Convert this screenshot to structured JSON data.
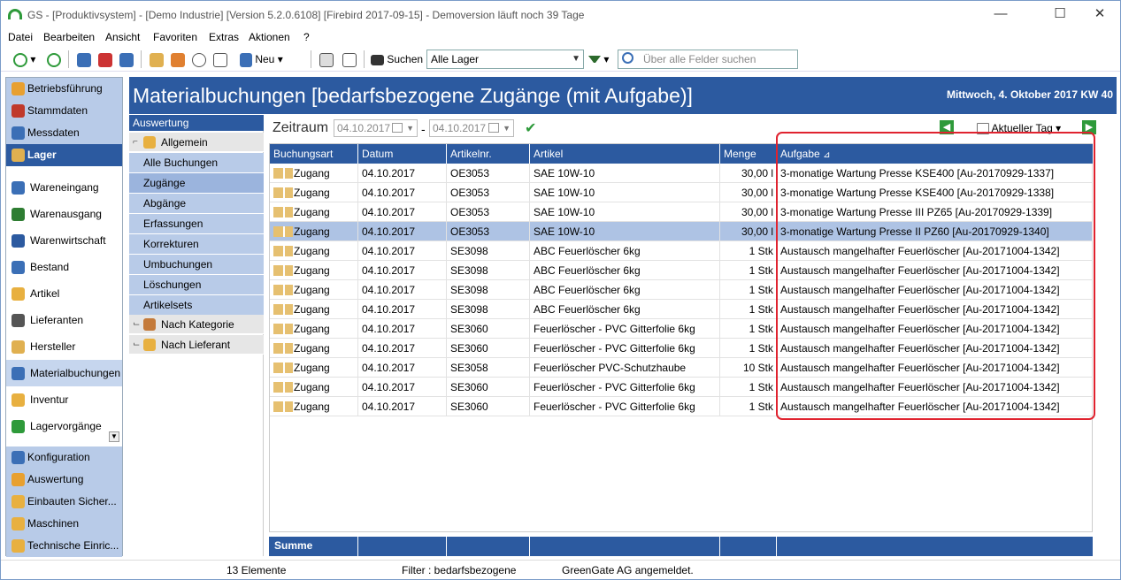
{
  "window": {
    "title": "GS - [Produktivsystem] - [Demo Industrie]  [Version  5.2.0.6108]  [Firebird 2017-09-15] - Demoversion läuft noch 39 Tage",
    "controls": [
      "—",
      "☐",
      "✕"
    ]
  },
  "menu": [
    "Datei",
    "Bearbeiten",
    "Ansicht",
    "Favoriten",
    "Extras",
    "Aktionen",
    "?"
  ],
  "toolbar": {
    "new_label": "Neu",
    "search_label": "Suchen",
    "store_value": "Alle Lager",
    "search_placeholder": "Über alle Felder suchen"
  },
  "sidebar": {
    "top_items": [
      {
        "label": "Betriebsführung",
        "icon": "sun-icon"
      },
      {
        "label": "Stammdaten",
        "icon": "books-icon"
      },
      {
        "label": "Messdaten",
        "icon": "pin-icon"
      },
      {
        "label": "Lager",
        "icon": "warehouse-icon",
        "active": true
      }
    ],
    "lager_items": [
      {
        "label": "Wareneingang",
        "icon": "goods-in-icon"
      },
      {
        "label": "Warenausgang",
        "icon": "goods-out-icon"
      },
      {
        "label": "Warenwirtschaft",
        "icon": "network-icon"
      },
      {
        "label": "Bestand",
        "icon": "stock-icon"
      },
      {
        "label": "Artikel",
        "icon": "key-icon"
      },
      {
        "label": "Lieferanten",
        "icon": "supplier-icon"
      },
      {
        "label": "Hersteller",
        "icon": "factory-icon"
      },
      {
        "label": "Materialbuchungen",
        "icon": "booking-icon",
        "selected": true
      },
      {
        "label": "Inventur",
        "icon": "inventory-icon"
      },
      {
        "label": "Lagervorgänge",
        "icon": "process-icon"
      }
    ],
    "bottom_items": [
      {
        "label": "Konfiguration",
        "icon": "config-icon"
      },
      {
        "label": "Auswertung",
        "icon": "report-icon"
      },
      {
        "label": "Einbauten Sicher...",
        "icon": "folder-icon"
      },
      {
        "label": "Maschinen",
        "icon": "folder-icon"
      },
      {
        "label": "Technische Einric...",
        "icon": "folder-icon"
      }
    ]
  },
  "header": {
    "title": "Materialbuchungen [bedarfsbezogene Zugänge (mit Aufgabe)]",
    "date": "Mittwoch, 4. Oktober 2017  KW 40"
  },
  "leftpanel": {
    "title": "Auswertung",
    "groups": {
      "allgemein": "Allgemein",
      "nach_kategorie": "Nach Kategorie",
      "nach_lieferant": "Nach Lieferant"
    },
    "items": [
      "Alle Buchungen",
      "Zugänge",
      "Abgänge",
      "Erfassungen",
      "Korrekturen",
      "Umbuchungen",
      "Löschungen",
      "Artikelsets"
    ]
  },
  "zeitraum": {
    "label": "Zeitraum",
    "from": "04.10.2017",
    "dash": "-",
    "to": "04.10.2017",
    "range_option": "Aktueller Tag"
  },
  "grid": {
    "columns": [
      "Buchungsart",
      "Datum",
      "Artikelnr.",
      "Artikel",
      "Menge",
      "Aufgabe"
    ],
    "rows": [
      {
        "art": "Zugang",
        "datum": "04.10.2017",
        "nr": "OE3053",
        "artikel": "SAE 10W-10",
        "menge": "30,00 l",
        "aufgabe": "3-monatige Wartung Presse KSE400 [Au-20170929-1337]"
      },
      {
        "art": "Zugang",
        "datum": "04.10.2017",
        "nr": "OE3053",
        "artikel": "SAE 10W-10",
        "menge": "30,00 l",
        "aufgabe": "3-monatige Wartung Presse KSE400 [Au-20170929-1338]"
      },
      {
        "art": "Zugang",
        "datum": "04.10.2017",
        "nr": "OE3053",
        "artikel": "SAE 10W-10",
        "menge": "30,00 l",
        "aufgabe": "3-monatige Wartung Presse III PZ65 [Au-20170929-1339]"
      },
      {
        "art": "Zugang",
        "datum": "04.10.2017",
        "nr": "OE3053",
        "artikel": "SAE 10W-10",
        "menge": "30,00 l",
        "aufgabe": "3-monatige Wartung Presse II PZ60 [Au-20170929-1340]",
        "highlight": true
      },
      {
        "art": "Zugang",
        "datum": "04.10.2017",
        "nr": "SE3098",
        "artikel": "ABC Feuerlöscher  6kg",
        "menge": "1 Stk",
        "aufgabe": "Austausch mangelhafter Feuerlöscher [Au-20171004-1342]"
      },
      {
        "art": "Zugang",
        "datum": "04.10.2017",
        "nr": "SE3098",
        "artikel": "ABC Feuerlöscher  6kg",
        "menge": "1 Stk",
        "aufgabe": "Austausch mangelhafter Feuerlöscher [Au-20171004-1342]"
      },
      {
        "art": "Zugang",
        "datum": "04.10.2017",
        "nr": "SE3098",
        "artikel": "ABC Feuerlöscher  6kg",
        "menge": "1 Stk",
        "aufgabe": "Austausch mangelhafter Feuerlöscher [Au-20171004-1342]"
      },
      {
        "art": "Zugang",
        "datum": "04.10.2017",
        "nr": "SE3098",
        "artikel": "ABC Feuerlöscher  6kg",
        "menge": "1 Stk",
        "aufgabe": "Austausch mangelhafter Feuerlöscher [Au-20171004-1342]"
      },
      {
        "art": "Zugang",
        "datum": "04.10.2017",
        "nr": "SE3060",
        "artikel": "Feuerlöscher - PVC Gitterfolie 6kg",
        "menge": "1 Stk",
        "aufgabe": "Austausch mangelhafter Feuerlöscher [Au-20171004-1342]"
      },
      {
        "art": "Zugang",
        "datum": "04.10.2017",
        "nr": "SE3060",
        "artikel": "Feuerlöscher - PVC Gitterfolie 6kg",
        "menge": "1 Stk",
        "aufgabe": "Austausch mangelhafter Feuerlöscher [Au-20171004-1342]"
      },
      {
        "art": "Zugang",
        "datum": "04.10.2017",
        "nr": "SE3058",
        "artikel": "Feuerlöscher PVC-Schutzhaube",
        "menge": "10 Stk",
        "aufgabe": "Austausch mangelhafter Feuerlöscher [Au-20171004-1342]"
      },
      {
        "art": "Zugang",
        "datum": "04.10.2017",
        "nr": "SE3060",
        "artikel": "Feuerlöscher - PVC Gitterfolie 6kg",
        "menge": "1 Stk",
        "aufgabe": "Austausch mangelhafter Feuerlöscher [Au-20171004-1342]"
      },
      {
        "art": "Zugang",
        "datum": "04.10.2017",
        "nr": "SE3060",
        "artikel": "Feuerlöscher - PVC Gitterfolie 6kg",
        "menge": "1 Stk",
        "aufgabe": "Austausch mangelhafter Feuerlöscher [Au-20171004-1342]"
      }
    ],
    "sum_label": "Summe"
  },
  "status": {
    "count": "13 Elemente",
    "filter": "Filter : bedarfsbezogene",
    "user": "GreenGate AG angemeldet."
  },
  "colors": {
    "accent": "#2c5aa0",
    "nav_bg": "#b8cbe8",
    "highlight_row": "#aec3e4",
    "annotation": "#e0232f"
  }
}
